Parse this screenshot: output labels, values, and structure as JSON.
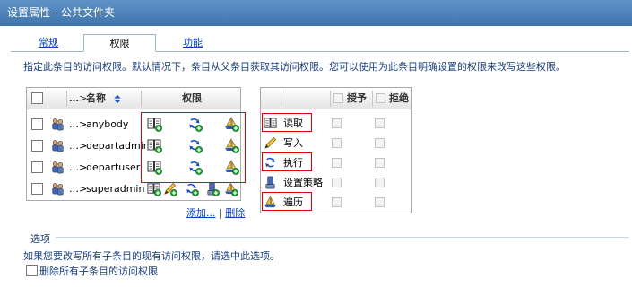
{
  "window": {
    "title": "设置属性 - 公共文件夹"
  },
  "tabs": [
    {
      "label": "常规",
      "active": false
    },
    {
      "label": "权限",
      "active": true
    },
    {
      "label": "功能",
      "active": false
    }
  ],
  "description": "指定此条目的访问权限。默认情况下，条目从父条目获取其访问权限。您可以使用为此条目明确设置的权限来改写这些权限。",
  "principals_table": {
    "headers": {
      "name": "名称",
      "permissions": "权限",
      "dots": "…"
    },
    "rows": [
      {
        "name": "anybody",
        "prefix": "…>",
        "icon": "group-icon",
        "permissions": [
          "read-icon",
          "execute-icon",
          "traverse-icon"
        ]
      },
      {
        "name": "departadmin",
        "prefix": "…>",
        "icon": "group-icon",
        "permissions": [
          "read-icon",
          "execute-icon",
          "traverse-icon"
        ]
      },
      {
        "name": "departuser",
        "prefix": "…>",
        "icon": "group-icon",
        "permissions": [
          "read-icon",
          "execute-icon",
          "traverse-icon"
        ]
      },
      {
        "name": "superadmin",
        "prefix": "…>",
        "icon": "group-icon",
        "permissions": [
          "read-icon",
          "write-icon",
          "execute-icon",
          "set-policy-icon",
          "traverse-icon"
        ]
      }
    ],
    "links": {
      "add": "添加...",
      "delete": "删除"
    }
  },
  "permissions_table": {
    "headers": {
      "grant": "授予",
      "deny": "拒绝"
    },
    "rows": [
      {
        "label": "读取",
        "icon": "read-icon"
      },
      {
        "label": "写入",
        "icon": "write-icon"
      },
      {
        "label": "执行",
        "icon": "execute-icon"
      },
      {
        "label": "设置策略",
        "icon": "set-policy-icon"
      },
      {
        "label": "遍历",
        "icon": "traverse-icon"
      }
    ]
  },
  "options": {
    "title": "选项",
    "description": "如果您要改写所有子条目的现有访问权限，请选中此选项。",
    "checkbox_label": "删除所有子条目的访问权限"
  },
  "colors": {
    "titlebar": "#4a80b8",
    "link": "#0a3ec9",
    "highlight": "#e00000"
  }
}
